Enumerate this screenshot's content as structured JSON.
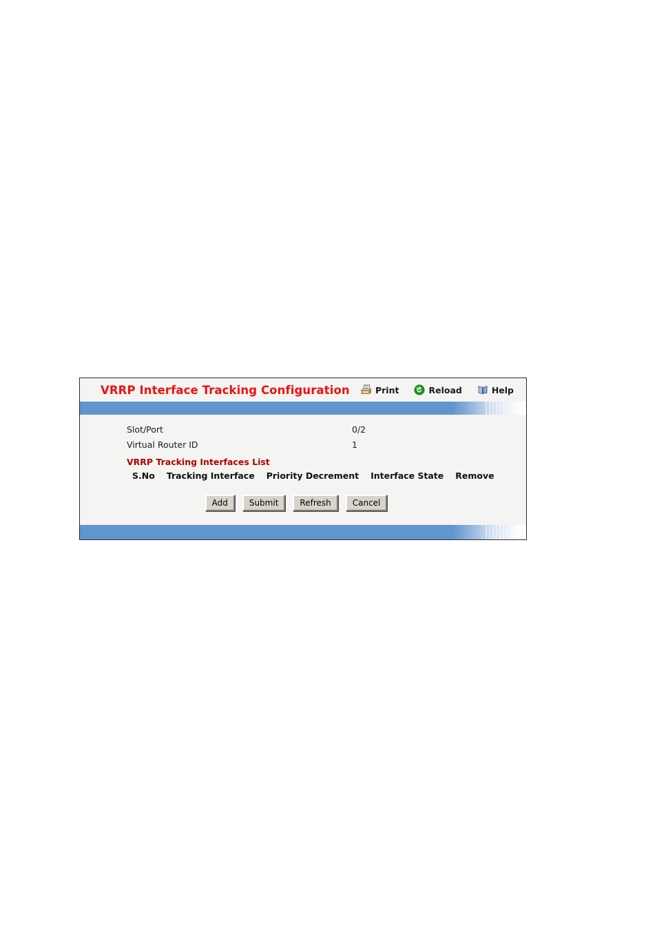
{
  "panel": {
    "title": "VRRP Interface Tracking Configuration",
    "actions": [
      {
        "label": "Print",
        "icon": "printer-icon"
      },
      {
        "label": "Reload",
        "icon": "reload-icon"
      },
      {
        "label": "Help",
        "icon": "help-book-icon"
      }
    ],
    "fields": [
      {
        "label": "Slot/Port",
        "value": "0/2"
      },
      {
        "label": "Virtual Router ID",
        "value": "1"
      }
    ],
    "section_heading": "VRRP Tracking Interfaces List",
    "table": {
      "columns": [
        "S.No",
        "Tracking Interface",
        "Priority Decrement",
        "Interface State",
        "Remove"
      ],
      "rows": []
    },
    "buttons": [
      {
        "label": "Add"
      },
      {
        "label": "Submit"
      },
      {
        "label": "Refresh"
      },
      {
        "label": "Cancel"
      }
    ]
  },
  "colors": {
    "title_red": "#ee1111",
    "heading_red": "#b00000",
    "bar_blue": "#6195cd",
    "content_bg": "#f4f4f2",
    "button_face": "#d7d3ca"
  }
}
